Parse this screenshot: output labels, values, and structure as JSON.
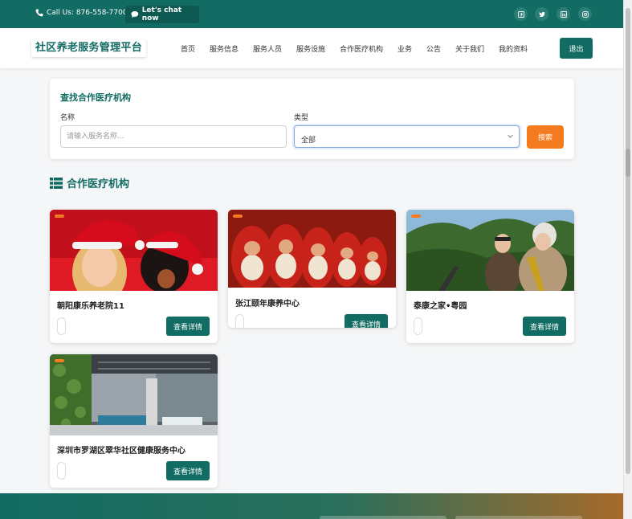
{
  "topbar": {
    "phone": "Call Us: 876-558-7700",
    "chat": "Let's chat now",
    "social_icons": [
      "facebook-icon",
      "twitter-icon",
      "linkedin-icon",
      "instagram-icon"
    ]
  },
  "header": {
    "logo": "社区养老服务管理平台",
    "nav": [
      "首页",
      "服务信息",
      "服务人员",
      "服务设施",
      "合作医疗机构",
      "业务",
      "公告",
      "关于我们",
      "我的资料"
    ],
    "logout": "退出"
  },
  "search": {
    "title": "查找合作医疗机构",
    "name_label": "名称",
    "name_placeholder": "请输入服务名称...",
    "name_value": "",
    "type_label": "类型",
    "type_value": "全部",
    "button": "搜索"
  },
  "section": {
    "title": "合作医疗机构"
  },
  "cards": [
    {
      "name": "朝阳康乐养老院11",
      "button": "查看详情"
    },
    {
      "name": "张江颐年康养中心",
      "button": "查看详情"
    },
    {
      "name": "泰康之家•粤园",
      "button": "查看详情"
    },
    {
      "name": "深圳市罗湖区翠华社区健康服务中心",
      "button": "查看详情"
    }
  ],
  "colors": {
    "primary": "#126c63",
    "accent": "#f47b20"
  }
}
